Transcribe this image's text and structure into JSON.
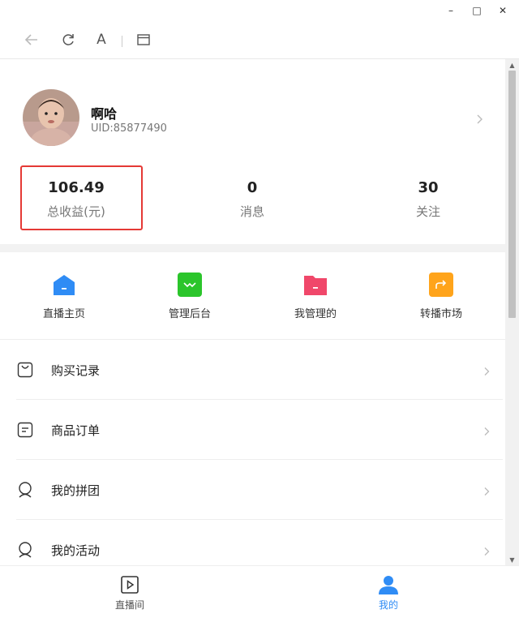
{
  "window": {
    "minimize": "–",
    "maximize": "□",
    "close": "✕"
  },
  "toolbar": {
    "font_label": "A"
  },
  "profile": {
    "name": "啊哈",
    "uid": "UID:85877490"
  },
  "stats": [
    {
      "value": "106.49",
      "label": "总收益(元)"
    },
    {
      "value": "0",
      "label": "消息"
    },
    {
      "value": "30",
      "label": "关注"
    }
  ],
  "shortcuts": [
    {
      "label": "直播主页",
      "icon": "home-icon",
      "color": "#2f8cf5"
    },
    {
      "label": "管理后台",
      "icon": "dashboard-icon",
      "color": "#2bc52b"
    },
    {
      "label": "我管理的",
      "icon": "folder-icon",
      "color": "#f0476a"
    },
    {
      "label": "转播市场",
      "icon": "share-icon",
      "color": "#ffa41b"
    }
  ],
  "menu": [
    {
      "label": "购买记录",
      "icon": "shopping-bag-icon"
    },
    {
      "label": "商品订单",
      "icon": "order-icon"
    },
    {
      "label": "我的拼团",
      "icon": "group-buy-icon"
    },
    {
      "label": "我的活动",
      "icon": "activity-icon"
    }
  ],
  "bottom_nav": [
    {
      "label": "直播间",
      "icon": "live-room-icon",
      "active": false
    },
    {
      "label": "我的",
      "icon": "user-icon",
      "active": true
    }
  ],
  "colors": {
    "accent": "#2f8cf5",
    "highlight_border": "#e53935"
  }
}
